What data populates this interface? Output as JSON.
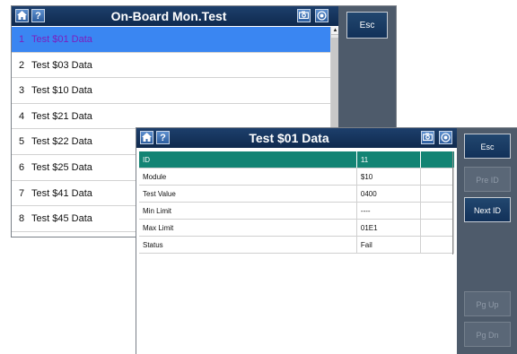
{
  "back_window": {
    "title": "On-Board Mon.Test",
    "help_label": "?",
    "esc_label": "Esc",
    "items": [
      {
        "num": "1",
        "label": "Test $01 Data",
        "selected": true
      },
      {
        "num": "2",
        "label": "Test $03 Data"
      },
      {
        "num": "3",
        "label": "Test $10 Data"
      },
      {
        "num": "4",
        "label": "Test $21 Data"
      },
      {
        "num": "5",
        "label": "Test $22 Data"
      },
      {
        "num": "6",
        "label": "Test $25 Data"
      },
      {
        "num": "7",
        "label": "Test $41 Data"
      },
      {
        "num": "8",
        "label": "Test $45 Data"
      }
    ]
  },
  "front_window": {
    "title": "Test $01 Data",
    "help_label": "?",
    "table": {
      "rows": [
        {
          "name": "ID",
          "value": "11"
        },
        {
          "name": "Module",
          "value": "$10"
        },
        {
          "name": "Test Value",
          "value": "0400"
        },
        {
          "name": "Min Limit",
          "value": "----"
        },
        {
          "name": "Max Limit",
          "value": "01E1"
        },
        {
          "name": "Status",
          "value": "Fail"
        }
      ]
    },
    "buttons": {
      "esc": "Esc",
      "pre_id": "Pre ID",
      "next_id": "Next ID",
      "pg_up": "Pg Up",
      "pg_dn": "Pg Dn"
    }
  },
  "icons": {
    "home": "home-icon",
    "help": "help-icon",
    "camera": "camera-icon",
    "record": "record-icon"
  },
  "colors": {
    "titlebar": "#173864",
    "selection": "#3a86f2",
    "table_header": "#138474",
    "side_panel": "#4e5b6b"
  }
}
